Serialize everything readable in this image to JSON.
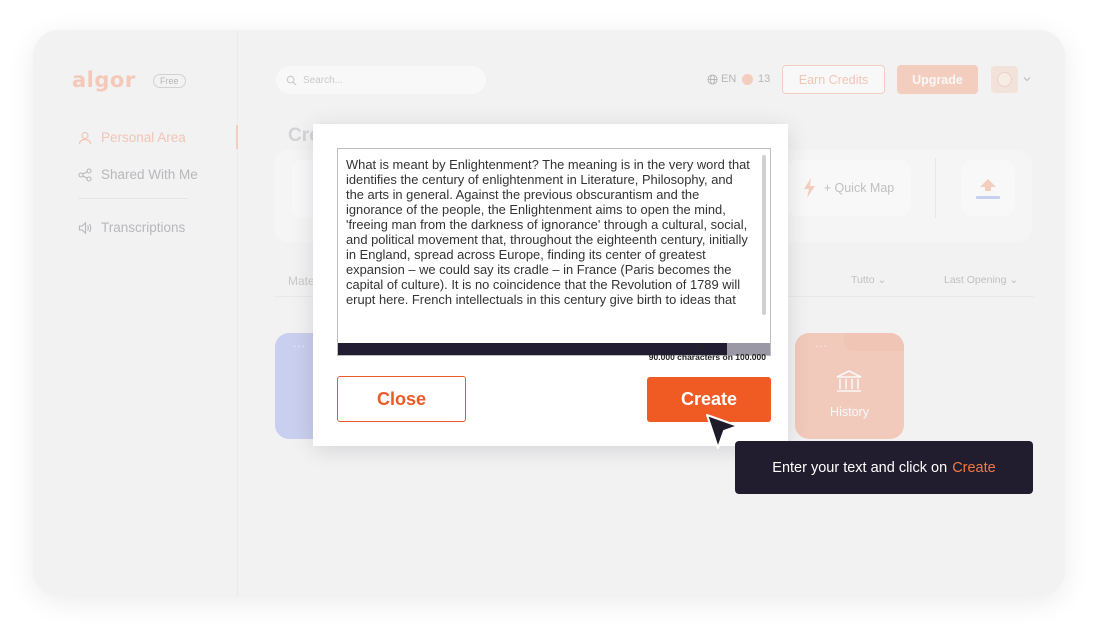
{
  "app": {
    "logo": "algor",
    "plan_badge": "Free"
  },
  "sidebar": {
    "items": [
      {
        "label": "Personal Area",
        "icon": "user-icon",
        "active": true
      },
      {
        "label": "Shared With Me",
        "icon": "share-icon",
        "active": false
      },
      {
        "label": "Transcriptions",
        "icon": "speaker-icon",
        "active": false
      }
    ]
  },
  "topbar": {
    "search_placeholder": "Search...",
    "language": "EN",
    "credits": "13",
    "earn_credits_label": "Earn Credits",
    "upgrade_label": "Upgrade"
  },
  "main": {
    "create_title": "Cre",
    "quick_map_label": "+ Quick Map",
    "materials_tab": "Mate",
    "filter_all": "Tutto",
    "filter_sort": "Last Opening",
    "folders": [
      {
        "label": "History",
        "color": "#f5ab8f"
      }
    ],
    "folder_dots": "···"
  },
  "modal": {
    "text": "What is meant by Enlightenment? The meaning is in the very word that identifies the century of enlightenment in Literature, Philosophy, and the arts in general. Against the previous obscurantism and the ignorance of the people, the Enlightenment aims to open the mind, 'freeing man from the darkness of ignorance' through a cultural, social, and political movement that, throughout the eighteenth century, initially in England, spread across Europe, finding its center of greatest expansion – we could say its cradle – in France (Paris becomes the capital of culture). It is no coincidence that the Revolution of 1789 will erupt here. French intellectuals in this century give birth to ideas that",
    "progress_fraction": 0.9,
    "char_count_label": "90.000 characters on 100.000",
    "close_label": "Close",
    "create_label": "Create"
  },
  "tooltip": {
    "text": "Enter your text and click on",
    "highlight": "Create"
  },
  "colors": {
    "accent": "#f05a23",
    "accent_light": "#f6b193",
    "dark": "#221d2e"
  }
}
